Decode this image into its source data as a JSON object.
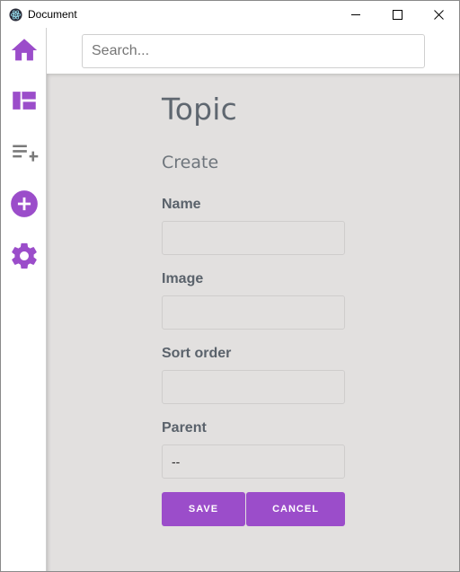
{
  "window": {
    "title": "Document"
  },
  "sidebar": {
    "items": [
      {
        "icon": "home-icon"
      },
      {
        "icon": "dashboard-icon"
      },
      {
        "icon": "playlist-add-icon"
      },
      {
        "icon": "add-circle-icon"
      },
      {
        "icon": "gear-icon"
      }
    ]
  },
  "search": {
    "placeholder": "Search...",
    "value": ""
  },
  "form": {
    "title": "Topic",
    "subtitle": "Create",
    "fields": [
      {
        "label": "Name",
        "value": ""
      },
      {
        "label": "Image",
        "value": ""
      },
      {
        "label": "Sort order",
        "value": ""
      },
      {
        "label": "Parent",
        "value": "--"
      }
    ],
    "save_label": "SAVE",
    "cancel_label": "CANCEL"
  },
  "colors": {
    "accent": "#9b4dca",
    "sidebar_gray_icon": "#7a7a7a",
    "content_bg": "#e2e0df"
  }
}
